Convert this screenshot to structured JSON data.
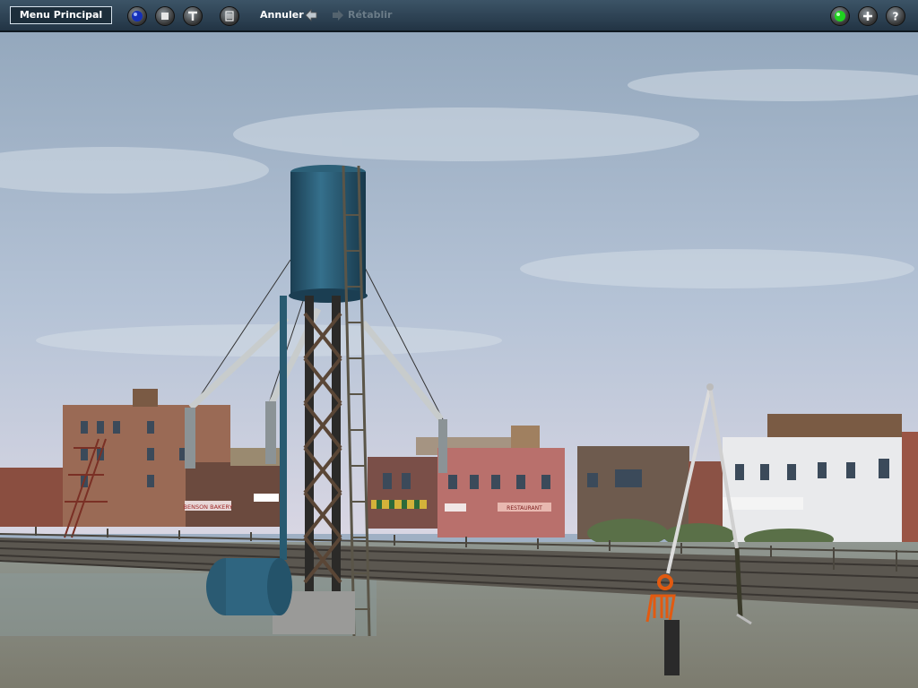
{
  "toolbar": {
    "menu_label": "Menu Principal",
    "undo_label": "Annuler",
    "redo_label": "Rétablir",
    "tool_icons": [
      "view-icon",
      "stop-icon",
      "wrench-icon",
      "delete-icon"
    ],
    "right_icons": [
      "status-light-icon",
      "add-icon",
      "help-icon"
    ]
  },
  "scene": {
    "shop_signs": [
      "BENSON BAKERY",
      "RESTAURANT"
    ]
  },
  "colors": {
    "toolbar_bg": "#2e4455",
    "status_green": "#1fd31f",
    "redo_disabled": "#6b7c88"
  }
}
